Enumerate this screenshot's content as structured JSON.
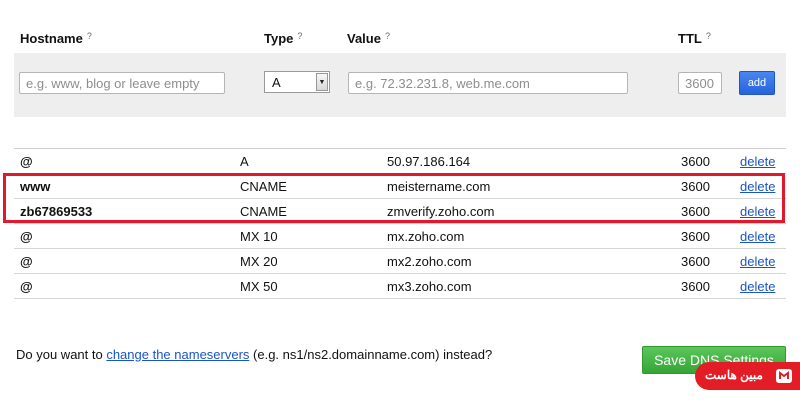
{
  "headers": {
    "hostname": "Hostname",
    "type": "Type",
    "value": "Value",
    "ttl": "TTL",
    "help_mark": "?"
  },
  "form": {
    "hostname_placeholder": "e.g. www, blog or leave empty",
    "type_selected": "A",
    "value_placeholder": "e.g. 72.32.231.8, web.me.com",
    "ttl_placeholder": "3600",
    "add_label": "add"
  },
  "records": [
    {
      "host": "@",
      "type": "A",
      "value": "50.97.186.164",
      "ttl": "3600",
      "action": "delete"
    },
    {
      "host": "www",
      "type": "CNAME",
      "value": "meistername.com",
      "ttl": "3600",
      "action": "delete"
    },
    {
      "host": "zb67869533",
      "type": "CNAME",
      "value": "zmverify.zoho.com",
      "ttl": "3600",
      "action": "delete"
    },
    {
      "host": "@",
      "type": "MX 10",
      "value": "mx.zoho.com",
      "ttl": "3600",
      "action": "delete"
    },
    {
      "host": "@",
      "type": "MX 20",
      "value": "mx2.zoho.com",
      "ttl": "3600",
      "action": "delete"
    },
    {
      "host": "@",
      "type": "MX 50",
      "value": "mx3.zoho.com",
      "ttl": "3600",
      "action": "delete"
    }
  ],
  "nameservers": {
    "prefix": "Do you want to ",
    "link": "change the nameservers",
    "suffix": " (e.g. ns1/ns2.domainname.com) instead?"
  },
  "save_label": "Save DNS Settings",
  "watermark": {
    "text": "مبین هاست",
    "icon": "host-logo-icon"
  },
  "colors": {
    "add_button": "#2d6be0",
    "save_button": "#3cab3c",
    "link": "#1a55c8",
    "highlight": "#e0192e",
    "watermark": "#e31d26"
  }
}
